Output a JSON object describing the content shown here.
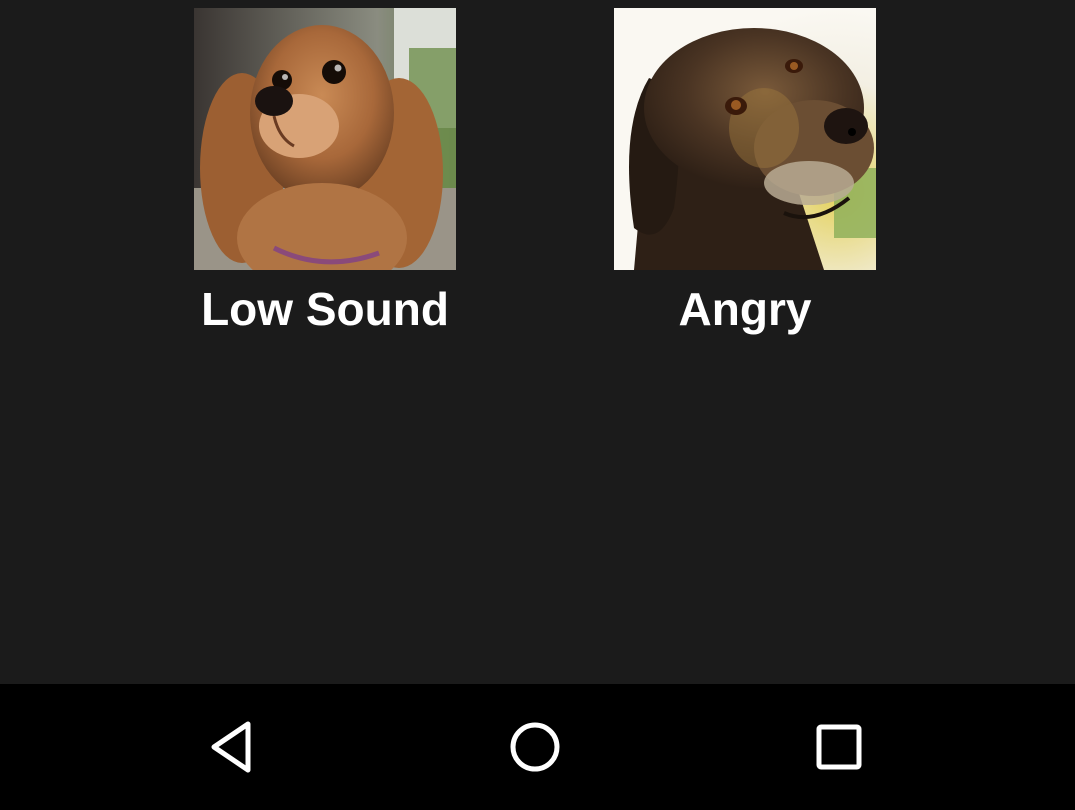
{
  "colors": {
    "background": "#1b1b1b",
    "navbar": "#000000",
    "label_text": "#ffffff",
    "nav_icon": "#ffffff"
  },
  "sounds": [
    {
      "label": "Low Sound",
      "image_icon": "cavalier-spaniel-photo"
    },
    {
      "label": "Angry",
      "image_icon": "labrador-photo"
    }
  ],
  "navbar": {
    "back_icon": "back-triangle-icon",
    "home_icon": "home-circle-icon",
    "recents_icon": "recents-square-icon"
  }
}
